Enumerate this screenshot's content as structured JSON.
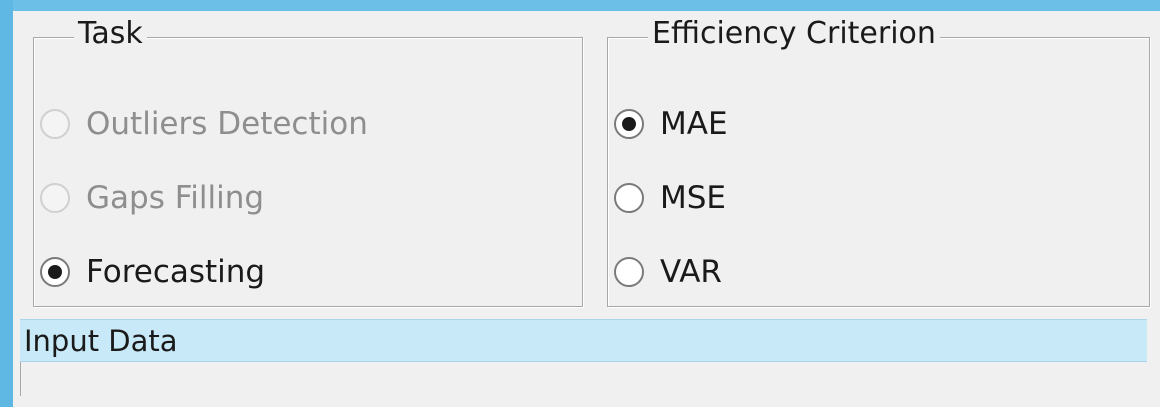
{
  "task_group": {
    "title": "Task",
    "options": [
      {
        "label": "Outliers Detection",
        "selected": false,
        "enabled": false
      },
      {
        "label": "Gaps Filling",
        "selected": false,
        "enabled": false
      },
      {
        "label": "Forecasting",
        "selected": true,
        "enabled": true
      }
    ]
  },
  "efficiency_group": {
    "title": "Efficiency Criterion",
    "options": [
      {
        "label": "MAE",
        "selected": true,
        "enabled": true
      },
      {
        "label": "MSE",
        "selected": false,
        "enabled": true
      },
      {
        "label": "VAR",
        "selected": false,
        "enabled": true
      }
    ]
  },
  "input_data": {
    "title": "Input Data"
  },
  "colors": {
    "accent_strip": "#5eb8e3",
    "section_header": "#c8e9f8",
    "panel_bg": "#f0f0f0",
    "disabled_text": "#8e8e8e"
  }
}
